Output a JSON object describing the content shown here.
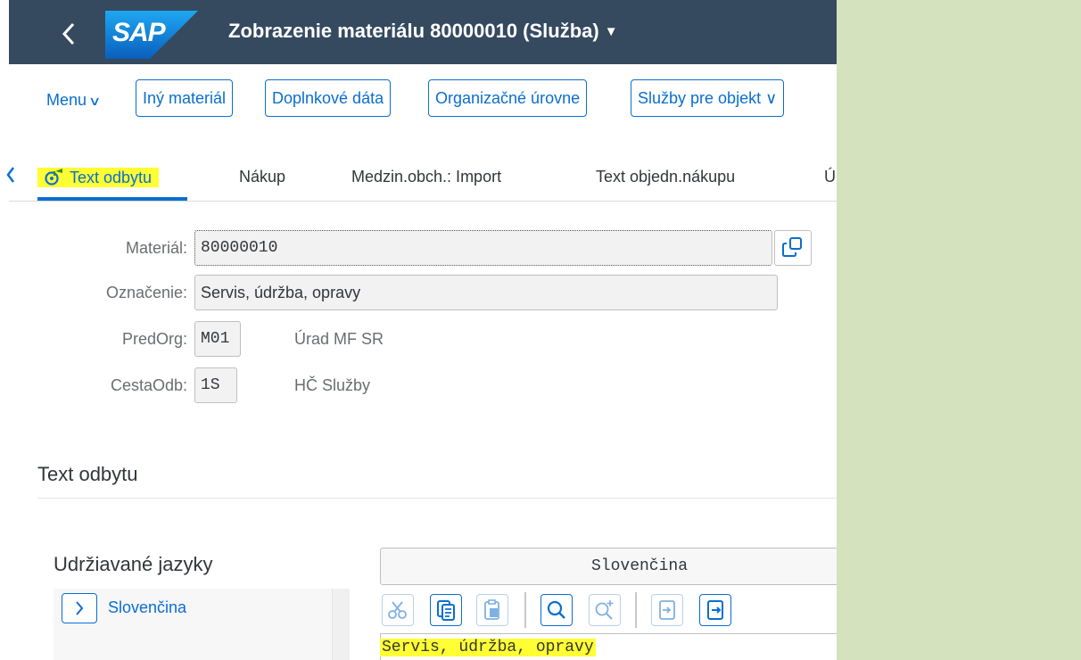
{
  "shell": {
    "back_icon": "chevron-left-icon",
    "logo_text": "SAP",
    "title": "Zobrazenie materiálu 80000010 (Služba)",
    "title_caret": "▼"
  },
  "toolbar": {
    "menu_label": "Menu",
    "menu_chevron": "∨",
    "buttons": [
      {
        "label": "Iný materiál"
      },
      {
        "label": "Doplnkové dáta"
      },
      {
        "label": "Organizačné úrovne"
      },
      {
        "label": "Služby pre objekt ∨"
      }
    ]
  },
  "tabs": {
    "left_arrow": "‹",
    "items": [
      {
        "label": "Text odbytu",
        "active": true,
        "icon": "sales-text-icon"
      },
      {
        "label": "Nákup"
      },
      {
        "label": "Medzin.obch.: Import"
      },
      {
        "label": "Text objedn.nákupu"
      },
      {
        "label": "Ú"
      }
    ]
  },
  "form": {
    "material_label": "Materiál:",
    "material_value": "80000010",
    "description_label": "Označenie:",
    "description_value": "Servis, údržba, opravy",
    "salesorg_label": "PredOrg:",
    "salesorg_value": "M01",
    "salesorg_desc": "Úrad MF SR",
    "distchannel_label": "CestaOdb:",
    "distchannel_value": "1S",
    "distchannel_desc": "HČ Služby"
  },
  "section": {
    "title": "Text odbytu"
  },
  "languages": {
    "title": "Udržiavané jazyky",
    "expand_icon": "›",
    "items": [
      "Slovenčina"
    ],
    "current_language": "Slovenčina"
  },
  "editor": {
    "tools": [
      "cut-icon",
      "copy-icon",
      "paste-icon",
      "search-icon",
      "search-next-icon",
      "import-icon",
      "export-icon"
    ],
    "text_line": "Servis, údržba, opravy"
  },
  "colors": {
    "shell_bg": "#354a5f",
    "accent": "#0a6ed1",
    "highlight": "#ffff33",
    "outer_bg": "#d5e2be"
  }
}
